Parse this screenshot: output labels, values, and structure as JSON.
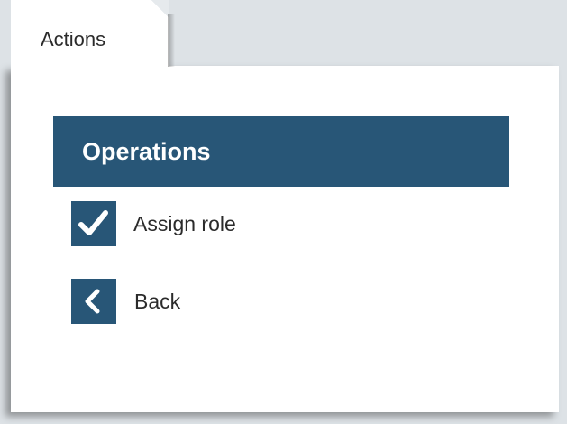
{
  "tabs": [
    {
      "label": "Actions",
      "active": true
    }
  ],
  "operations": {
    "title": "Operations",
    "items": [
      {
        "label": "Assign role",
        "icon": "check-icon"
      },
      {
        "label": "Back",
        "icon": "chevron-left-icon"
      }
    ]
  },
  "colors": {
    "accent": "#285677",
    "background": "#dde2e6",
    "panel": "#ffffff",
    "text": "#2b2b2b",
    "divider": "#cfcfcf"
  }
}
